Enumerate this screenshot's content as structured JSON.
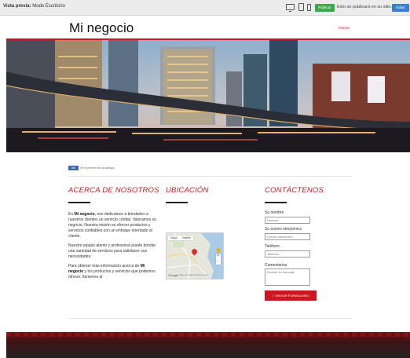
{
  "toolbar": {
    "preview_prefix": "Vista previa:",
    "preview_mode": "Modo Escritorio",
    "publish_label": "Publicar",
    "publish_note": "Esto se publicará en su sitio.",
    "edit_label": "Editar",
    "device_icons": [
      "desktop-icon",
      "tablet-icon",
      "phone-icon"
    ]
  },
  "site": {
    "logo": "Mi negocio",
    "nav_item": "INICIO",
    "accent_color": "#c9191e"
  },
  "social": {
    "like_label": "Me gusta",
    "like_text": "Sé el primero de tus amigos"
  },
  "about": {
    "title": "ACERCA DE NOSOTROS",
    "p1_pre": "En ",
    "p1_bold": "Mi negocio",
    "p1_post": ", nos dedicamos a brindarles a nuestros clientes un servicio cordial. Valoramos su negocio. Nuestra misión es ofrecer productos y servicios confiables con un enfoque orientado al cliente.",
    "p2": "Nuestro equipo atento y profesional puede brindar una variedad de servicios para satisfacer sus necesidades.",
    "p3_pre": "Para obtener más información acerca de ",
    "p3_bold": "Mi negocio",
    "p3_post": " y los productos y servicios que podemos ofrecer, llámenos al"
  },
  "location": {
    "title": "UBICACIÓN",
    "map_tab_map": "Mapa",
    "map_tab_sat": "Satélite",
    "map_logo": "Google",
    "map_credit": "Datos del mapa  Términos de uso"
  },
  "contact": {
    "title": "CONTÁCTENOS",
    "name_label": "Su nombre",
    "name_placeholder": "Nombre",
    "email_label": "Su correo electrónico",
    "email_placeholder": "Correo electrónico",
    "phone_label": "Teléfono",
    "phone_placeholder": "Teléfono",
    "comments_label": "Comentarios",
    "comments_placeholder": "Escriba su mensaje",
    "submit_label": "✓ ENVIAR FORMULARIO"
  }
}
